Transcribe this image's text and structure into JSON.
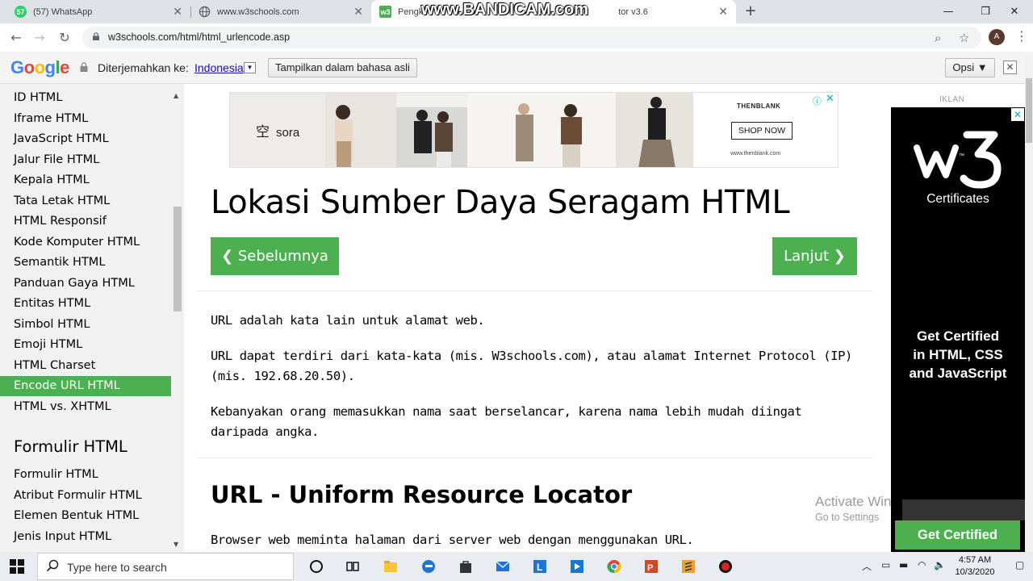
{
  "watermark": "www.BANDICAM.com",
  "tabs": [
    {
      "title": "(57) WhatsApp",
      "favicon_color": "#25d366",
      "favicon_text": "57"
    },
    {
      "title": "www.w3schools.com",
      "favicon_color": "#5f6368",
      "favicon_text": ""
    },
    {
      "title": "Pengk",
      "title_suffix": "tor v3.6",
      "favicon_color": "#4caf50",
      "favicon_text": "w3"
    }
  ],
  "address": {
    "url": "w3schools.com/html/html_urlencode.asp",
    "avatar_letter": "A"
  },
  "translate_bar": {
    "logo": "Google",
    "label": "Diterjemahkan ke:",
    "language": "Indonesia",
    "show_original": "Tampilkan dalam bahasa asli",
    "options": "Opsi ▼",
    "close": "✕"
  },
  "sidebar": {
    "items": [
      "ID HTML",
      "Iframe HTML",
      "JavaScript HTML",
      "Jalur File HTML",
      "Kepala HTML",
      "Tata Letak HTML",
      "HTML Responsif",
      "Kode Komputer HTML",
      "Semantik HTML",
      "Panduan Gaya HTML",
      "Entitas HTML",
      "Simbol HTML",
      "Emoji HTML",
      "HTML Charset",
      "Encode URL HTML",
      "HTML vs. XHTML"
    ],
    "active_index": 14,
    "section_heading": "Formulir HTML",
    "section_items": [
      "Formulir HTML",
      "Atribut Formulir HTML",
      "Elemen Bentuk HTML",
      "Jenis Input HTML"
    ]
  },
  "ad_banner": {
    "sora": "sora",
    "sora_kanji": "空",
    "brand": "THENBLANK",
    "cta": "SHOP NOW",
    "site": "www.thenblank.com"
  },
  "content": {
    "title": "Lokasi Sumber Daya Seragam HTML",
    "prev_label": "❮ Sebelumnya",
    "next_label": "Lanjut ❯",
    "p1": "URL adalah kata lain untuk alamat web.",
    "p2": "URL dapat terdiri dari kata-kata (mis. W3schools.com), atau alamat Internet Protocol (IP) (mis. 192.68.20.50).",
    "p3": "Kebanyakan orang memasukkan nama saat berselancar, karena nama lebih mudah diingat daripada angka.",
    "h2": "URL - Uniform Resource Locator",
    "p4": "Browser web meminta halaman dari server web dengan menggunakan URL."
  },
  "right_ad": {
    "label": "IKLAN",
    "certificates": "Certificates",
    "get_certified": "Get Certified",
    "line2": "in HTML, CSS",
    "line3": "and JavaScript",
    "button": "Get Certified"
  },
  "activation": {
    "title": "Activate Win",
    "subtitle": "Go to Settings"
  },
  "taskbar": {
    "search_placeholder": "Type here to search",
    "time": "4:57 AM",
    "date": "10/3/2020"
  },
  "colors": {
    "w3_green": "#4caf50",
    "ad_cyan": "#00aecd",
    "link_blue": "#1a0dab"
  }
}
